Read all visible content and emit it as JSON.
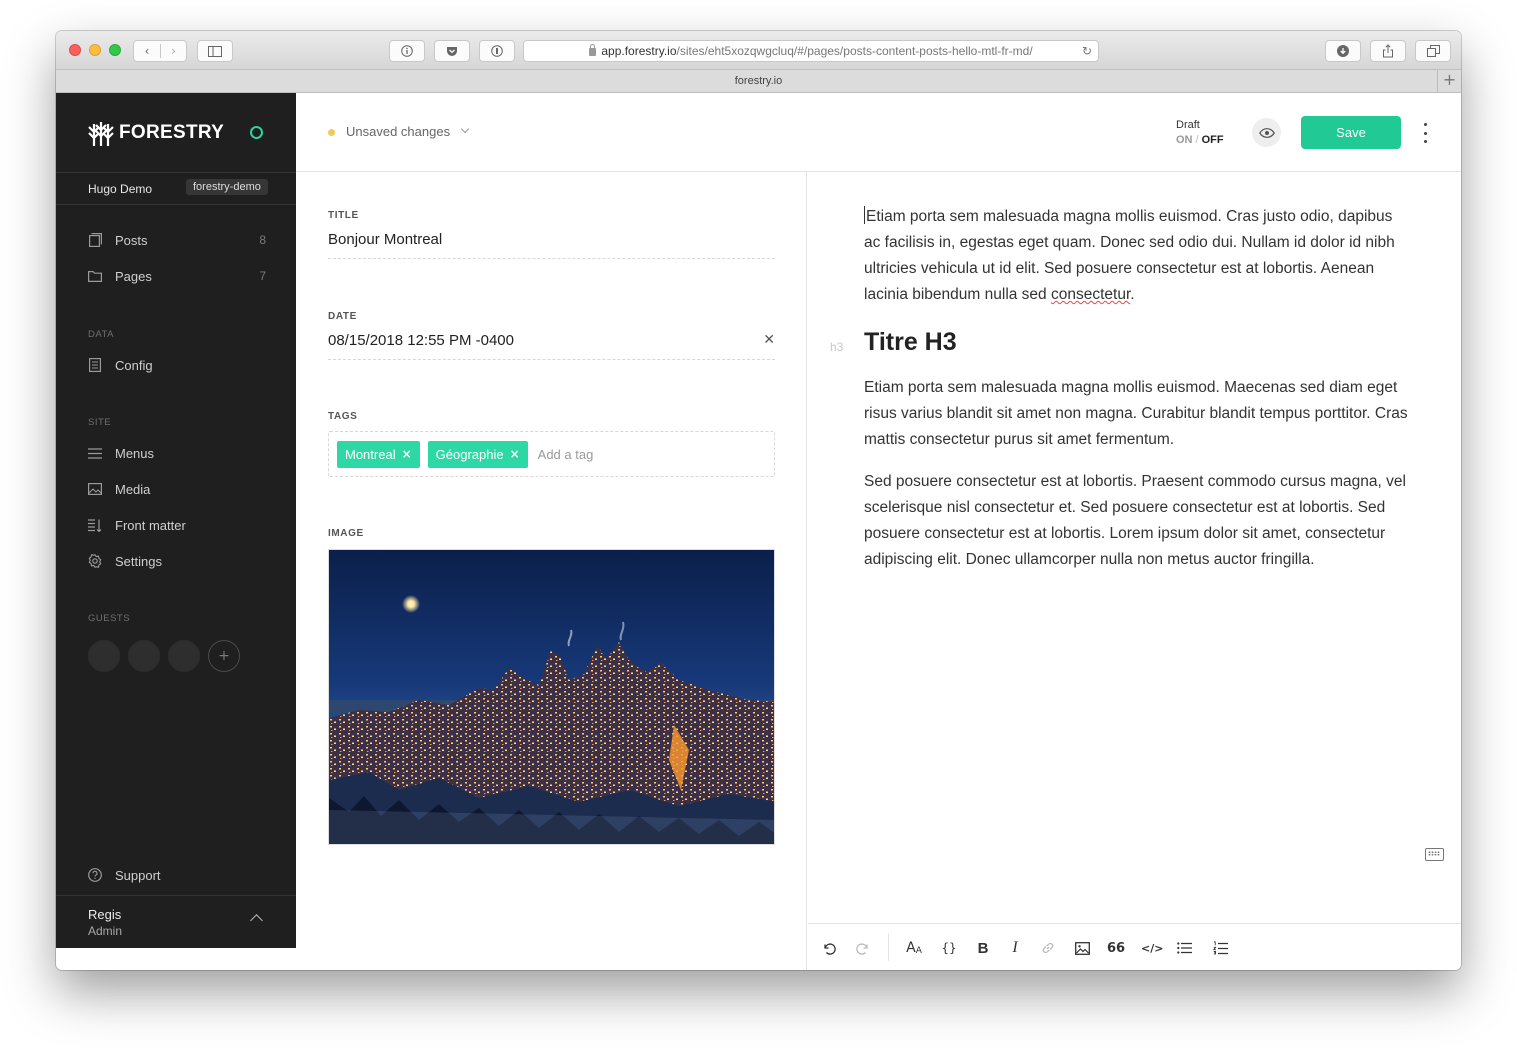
{
  "browser": {
    "url_host": "app.forestry.io",
    "url_path": "/sites/eht5xozqwgcluq/#/pages/posts-content-posts-hello-mtl-fr-md/",
    "tab_title": "forestry.io"
  },
  "sidebar": {
    "brand": "FORESTRY",
    "site_name": "Hugo Demo",
    "site_slug": "forestry-demo",
    "content_items": [
      {
        "label": "Posts",
        "count": "8"
      },
      {
        "label": "Pages",
        "count": "7"
      }
    ],
    "data_label": "DATA",
    "data_items": [
      {
        "label": "Config"
      }
    ],
    "site_label": "SITE",
    "site_items": [
      {
        "label": "Menus"
      },
      {
        "label": "Media"
      },
      {
        "label": "Front matter"
      },
      {
        "label": "Settings"
      }
    ],
    "guests_label": "GUESTS",
    "add_guest": "+",
    "support_label": "Support",
    "user": {
      "name": "Regis",
      "role": "Admin"
    }
  },
  "header": {
    "unsaved": "Unsaved changes",
    "draft_label": "Draft",
    "draft_on": "ON",
    "draft_sep": "/",
    "draft_off": "OFF",
    "save_label": "Save"
  },
  "form": {
    "title_label": "TITLE",
    "title_value": "Bonjour Montreal",
    "date_label": "DATE",
    "date_value": "08/15/2018 12:55 PM -0400",
    "tags_label": "TAGS",
    "tags": [
      {
        "label": "Montreal"
      },
      {
        "label": "Géographie"
      }
    ],
    "tag_placeholder": "Add a tag",
    "image_label": "IMAGE"
  },
  "editor": {
    "p1_before": "Etiam porta sem malesuada magna mollis euismod. Cras justo odio, dapibus ac facilisis in, egestas eget quam. Donec sed odio dui. Nullam id dolor id nibh ultricies vehicula ut id elit. Sed posuere consectetur est at lobortis. Aenean lacinia bibendum nulla sed ",
    "p1_misspelled": "consectetur",
    "p1_after": ".",
    "h3_tag": "h3",
    "h3_text": "Titre H3",
    "p2": "Etiam porta sem malesuada magna mollis euismod. Maecenas sed diam eget risus varius blandit sit amet non magna. Curabitur blandit tempus porttitor. Cras mattis consectetur purus sit amet fermentum.",
    "p3": "Sed posuere consectetur est at lobortis. Praesent commodo cursus magna, vel scelerisque nisl consectetur et. Sed posuere consectetur est at lobortis. Sed posuere consectetur est at lobortis. Lorem ipsum dolor sit amet, consectetur adipiscing elit. Donec ullamcorper nulla non metus auctor fringilla."
  },
  "toolbar": {
    "heading": "A",
    "heading_small": "A",
    "code_block": "{}",
    "bold": "B",
    "italic": "I",
    "quote": "66",
    "code": "</>"
  },
  "colors": {
    "accent": "#21c995",
    "tag": "#2ed8a5",
    "sidebar_bg": "#1f1f1f",
    "unsaved_dot": "#f5c85a",
    "status_ring": "#2bd4a3"
  }
}
